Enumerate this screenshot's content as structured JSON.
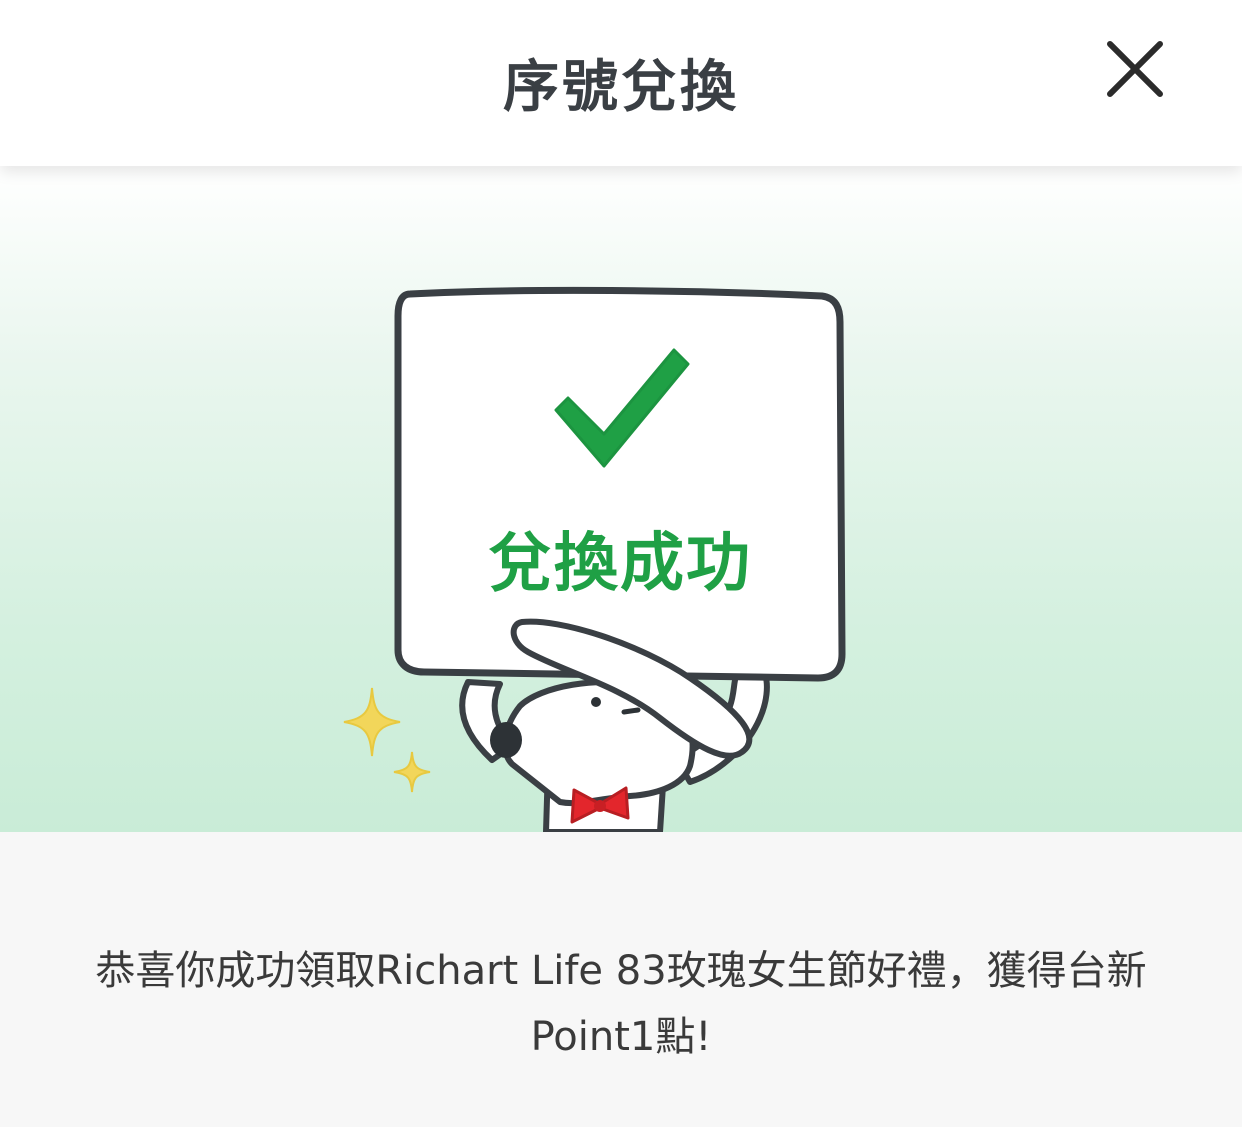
{
  "header": {
    "title": "序號兌換",
    "close_icon": "close-icon"
  },
  "hero": {
    "status_text": "兌換成功",
    "check_icon": "checkmark-icon",
    "accent_color": "#1fa045"
  },
  "message": {
    "text": "恭喜你成功領取Richart Life 83玫瑰女生節好禮，獲得台新Point1點!"
  }
}
